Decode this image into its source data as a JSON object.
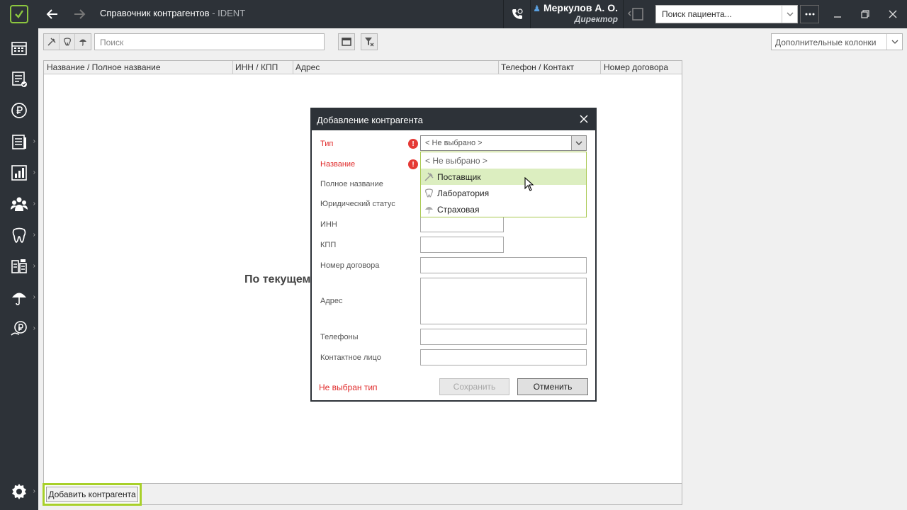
{
  "window": {
    "title": "Справочник контрагентов",
    "app_name": "IDENT",
    "title_separator": " - "
  },
  "user": {
    "name": "Меркулов А. О.",
    "role": "Директор"
  },
  "patient_search": {
    "placeholder": "Поиск пациента..."
  },
  "toolbar": {
    "search_placeholder": "Поиск",
    "additional_columns": "Дополнительные колонки"
  },
  "grid": {
    "columns": [
      "Название / Полное название",
      "ИНН / КПП",
      "Адрес",
      "Телефон / Контакт",
      "Номер договора"
    ],
    "empty_text": "По текущем"
  },
  "bottom": {
    "add_button": "Добавить контрагента"
  },
  "dialog": {
    "title": "Добавление контрагента",
    "labels": {
      "type": "Тип",
      "name": "Название",
      "full_name": "Полное название",
      "legal_status": "Юридический статус",
      "inn": "ИНН",
      "kpp": "КПП",
      "contract_number": "Номер договора",
      "address": "Адрес",
      "phones": "Телефоны",
      "contact_person": "Контактное лицо"
    },
    "type_value": "< Не выбрано >",
    "type_options": [
      "< Не выбрано >",
      "Поставщик",
      "Лаборатория",
      "Страховая"
    ],
    "highlighted_option": "Поставщик",
    "status_error": "Не выбран тип",
    "save_label": "Сохранить",
    "cancel_label": "Отменить"
  },
  "colors": {
    "chrome": "#2d3238",
    "accent_green": "#a8d02a",
    "error_red": "#e53935",
    "highlight": "#dceec0"
  }
}
